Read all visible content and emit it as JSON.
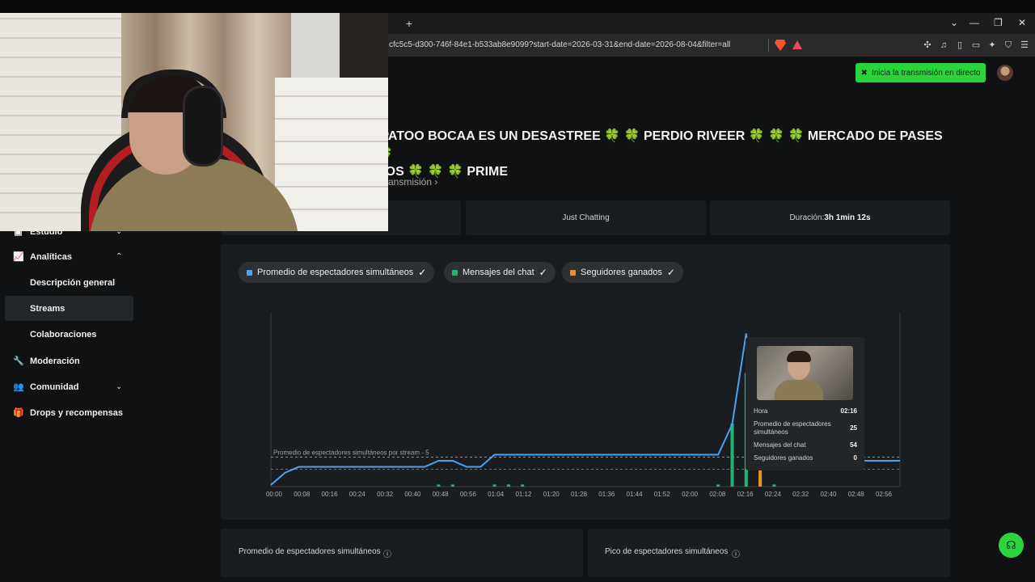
{
  "browser": {
    "new_tab": "+",
    "url": "cfc5c5-d300-746f-84e1-b533ab8e9099?start-date=2026-03-31&end-date=2026-08-04&filter=all",
    "controls": [
      "⌄",
      "—",
      "❐",
      "✕"
    ]
  },
  "header": {
    "go_live_label": "Inicia la transmisión en directo"
  },
  "stream": {
    "title_line1": "IPATOO BOCAA ES UN DESASTREE 🍀 🍀 PERDIO RIVEER 🍀 🍀 🍀 MERCADO DE PASES 🍀",
    "title_line2": "EOS 🍀 🍀 🍀 PRIME",
    "link": "ansmisión ›",
    "category": "Just Chatting",
    "duration_label": "Duración: ",
    "duration_value": "3h 1min 12s"
  },
  "sidebar": {
    "items": [
      {
        "label": "Estudio",
        "icon": "studio-icon"
      },
      {
        "label": "Analíticas",
        "icon": "analytics-icon"
      },
      {
        "label": "Descripción general"
      },
      {
        "label": "Streams"
      },
      {
        "label": "Colaboraciones"
      },
      {
        "label": "Moderación",
        "icon": "wrench-icon"
      },
      {
        "label": "Comunidad",
        "icon": "community-icon"
      },
      {
        "label": "Drops y recompensas",
        "icon": "drops-icon"
      }
    ]
  },
  "legend": {
    "avg_viewers": "Promedio de espectadores simultáneos",
    "chat_messages": "Mensajes del chat",
    "followers": "Seguidores ganados",
    "colors": {
      "avg_viewers": "#4aa3f0",
      "chat_messages": "#22b573",
      "followers": "#e8902a"
    }
  },
  "chart_data": {
    "type": "line",
    "x": [
      "00:00",
      "00:04",
      "00:08",
      "00:12",
      "00:16",
      "00:20",
      "00:24",
      "00:28",
      "00:32",
      "00:36",
      "00:40",
      "00:44",
      "00:48",
      "00:52",
      "00:56",
      "01:00",
      "01:04",
      "01:08",
      "01:12",
      "01:16",
      "01:20",
      "01:24",
      "01:28",
      "01:32",
      "01:36",
      "01:40",
      "01:44",
      "01:48",
      "01:52",
      "01:56",
      "02:00",
      "02:04",
      "02:08",
      "02:12",
      "02:16",
      "02:20",
      "02:24",
      "02:28",
      "02:32",
      "02:36",
      "02:40",
      "02:44",
      "02:48",
      "02:52",
      "02:56",
      "03:00"
    ],
    "tick_labels": [
      "00:00",
      "00:08",
      "00:16",
      "00:24",
      "00:32",
      "00:40",
      "00:48",
      "00:56",
      "01:04",
      "01:12",
      "01:20",
      "01:28",
      "01:36",
      "01:44",
      "01:52",
      "02:00",
      "02:08",
      "02:16",
      "02:24",
      "02:32",
      "02:40",
      "02:48",
      "02:56"
    ],
    "series": [
      {
        "name": "Promedio de espectadores simultáneos",
        "values": [
          0,
          2,
          3,
          3,
          3,
          3,
          3,
          3,
          3,
          3,
          3,
          3,
          4,
          4,
          3,
          3,
          5,
          5,
          5,
          5,
          5,
          5,
          5,
          5,
          5,
          5,
          5,
          5,
          5,
          5,
          5,
          5,
          5,
          10,
          25,
          4,
          4,
          4,
          4,
          4,
          4,
          4,
          4,
          4,
          4,
          4
        ]
      },
      {
        "name": "Mensajes del chat",
        "values": [
          0,
          0,
          0,
          0,
          0,
          0,
          0,
          0,
          0,
          0,
          0,
          0,
          1,
          1,
          0,
          0,
          1,
          1,
          1,
          0,
          0,
          0,
          0,
          0,
          0,
          0,
          0,
          0,
          0,
          0,
          0,
          0,
          1,
          30,
          54,
          6,
          1,
          0,
          0,
          0,
          0,
          0,
          0,
          0,
          0,
          0
        ]
      },
      {
        "name": "Seguidores ganados",
        "values": [
          0,
          0,
          0,
          0,
          0,
          0,
          0,
          0,
          0,
          0,
          0,
          0,
          0,
          0,
          0,
          0,
          0,
          0,
          0,
          0,
          0,
          0,
          0,
          0,
          0,
          0,
          0,
          0,
          0,
          0,
          0,
          0,
          0,
          0,
          0,
          1,
          0,
          0,
          0,
          0,
          0,
          0,
          0,
          0,
          0,
          0
        ]
      }
    ],
    "avg_line_label": "Promedio de espectadores simultáneos por stream - 5",
    "avg_line_value": 5,
    "ylim": [
      0,
      26
    ]
  },
  "tooltip": {
    "rows": [
      {
        "label": "Hora",
        "value": "02:16"
      },
      {
        "label": "Promedio de espectadores simultáneos",
        "value": "25"
      },
      {
        "label": "Mensajes del chat",
        "value": "54"
      },
      {
        "label": "Seguidores ganados",
        "value": "0"
      }
    ]
  },
  "stats": {
    "avg_label": "Promedio de espectadores simultáneos",
    "peak_label": "Pico de espectadores simultáneos",
    "info_icon": "ⓘ"
  }
}
